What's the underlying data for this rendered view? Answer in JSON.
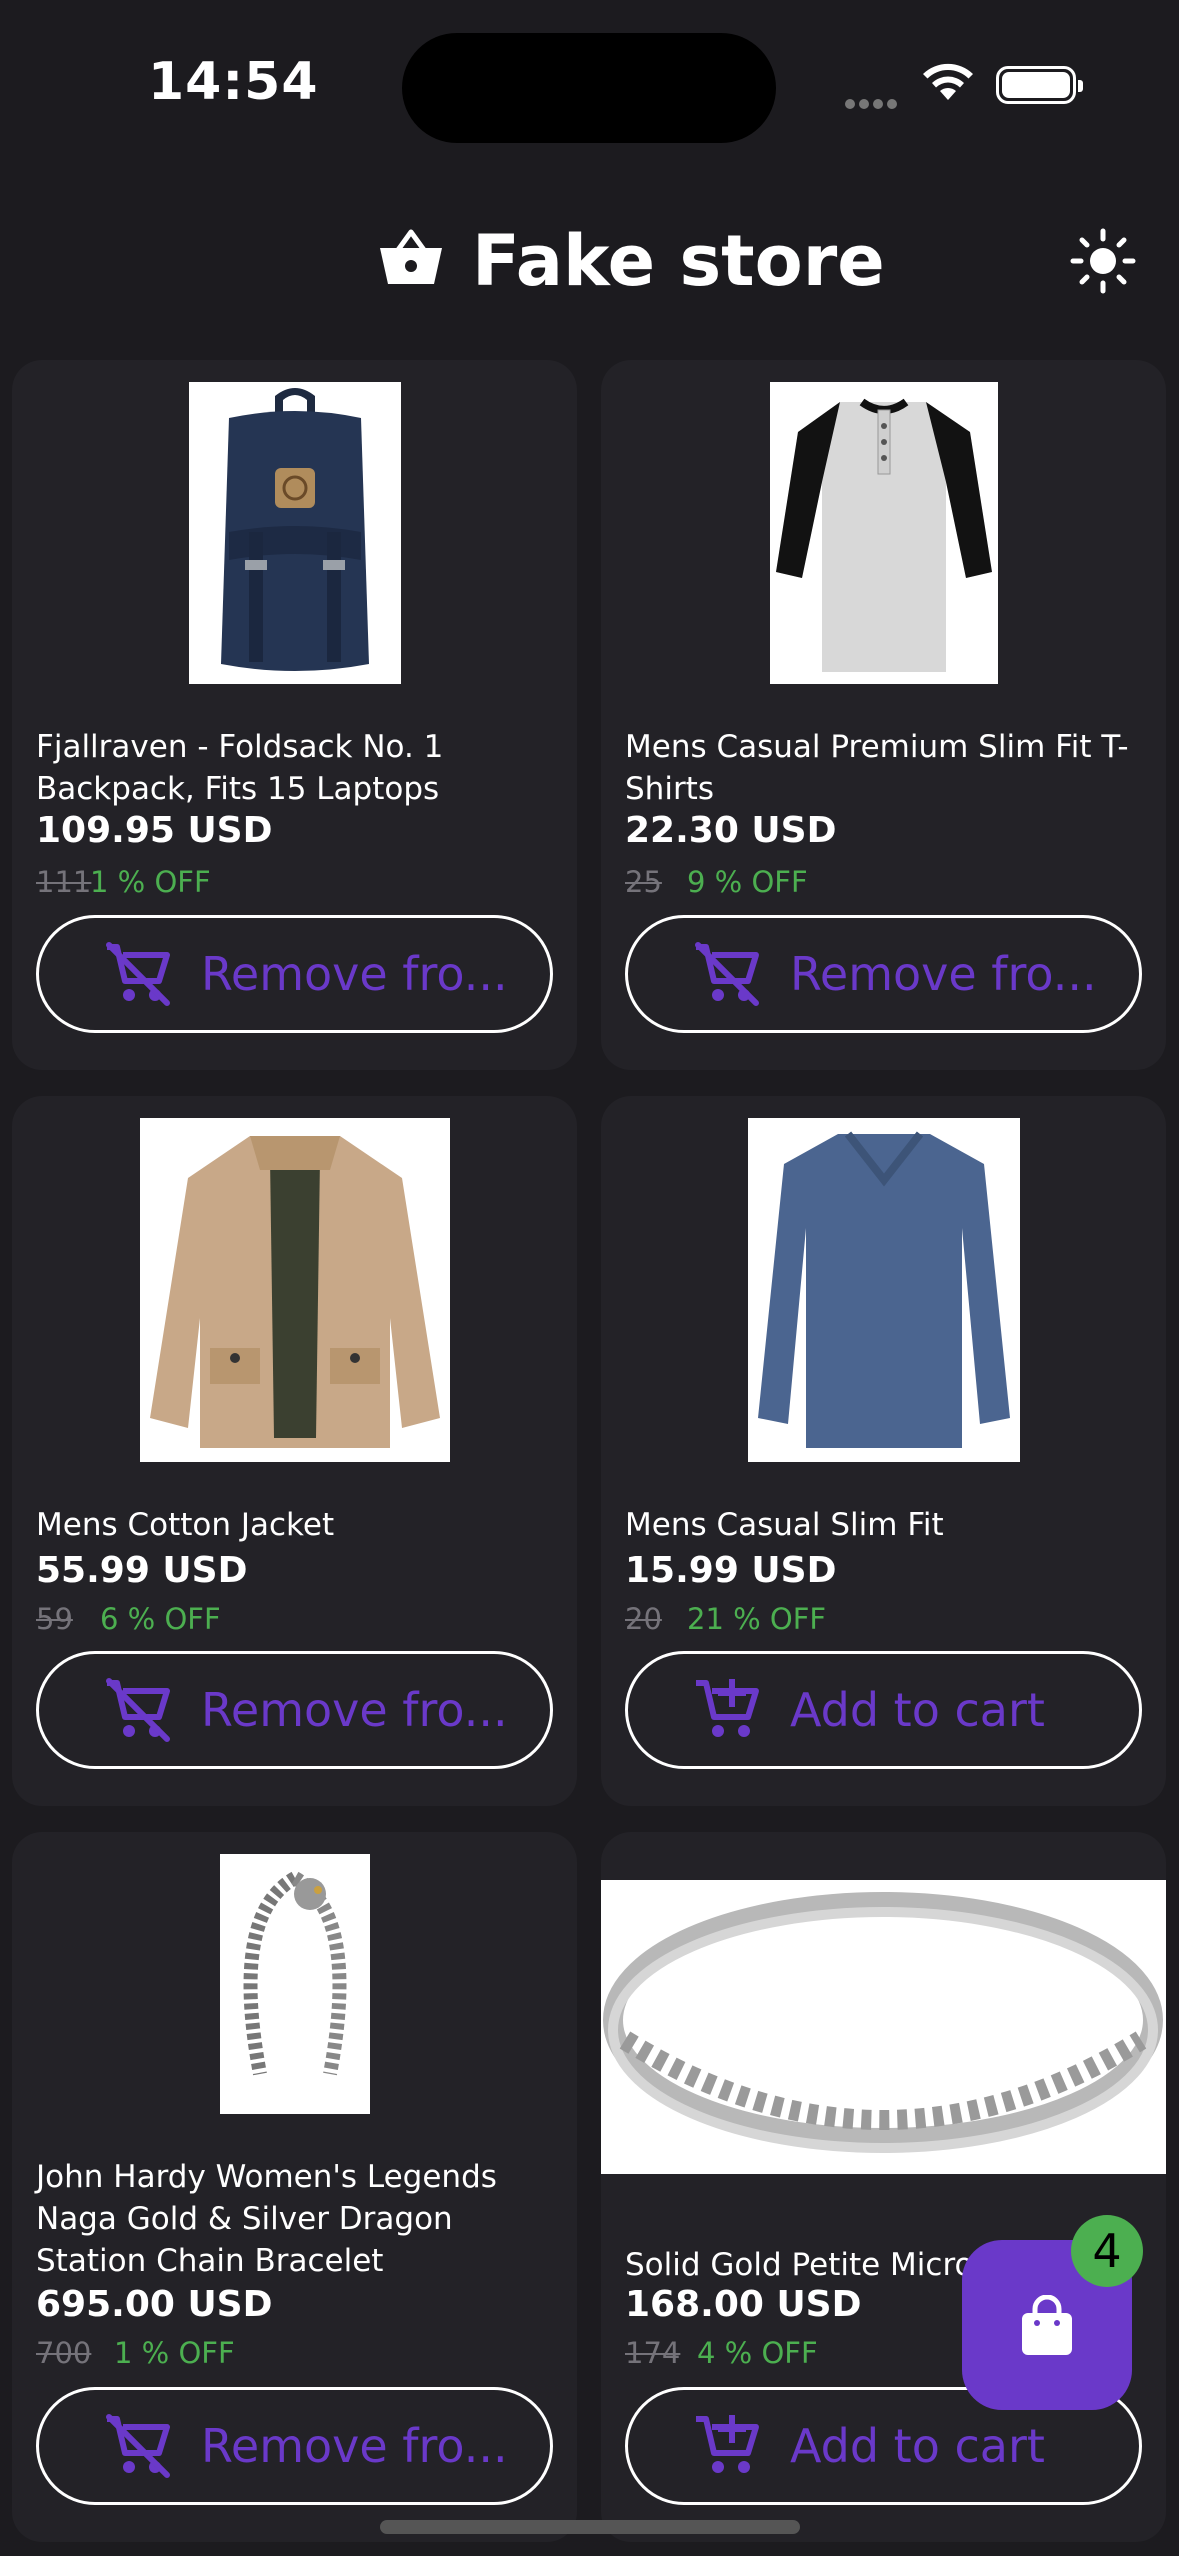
{
  "status": {
    "time": "14:54"
  },
  "header": {
    "title": "Fake store"
  },
  "cart": {
    "count": "4"
  },
  "products": [
    {
      "name": "Fjallraven - Foldsack No. 1 Backpack, Fits 15 Laptops",
      "price": "109.95 USD",
      "old": "111",
      "off": "1 % OFF",
      "button": "Remove fro...",
      "in_cart": true
    },
    {
      "name": "Mens Casual Premium Slim Fit T-Shirts",
      "price": "22.30 USD",
      "old": "25",
      "off": "9 % OFF",
      "button": "Remove fro...",
      "in_cart": true
    },
    {
      "name": "Mens Cotton Jacket",
      "price": "55.99 USD",
      "old": "59",
      "off": "6 % OFF",
      "button": "Remove fro...",
      "in_cart": true
    },
    {
      "name": "Mens Casual Slim Fit",
      "price": "15.99 USD",
      "old": "20",
      "off": "21 % OFF",
      "button": "Add to cart",
      "in_cart": false
    },
    {
      "name": "John Hardy Women's Legends Naga Gold & Silver Dragon Station Chain Bracelet",
      "price": "695.00 USD",
      "old": "700",
      "off": "1 % OFF",
      "button": "Remove fro...",
      "in_cart": true
    },
    {
      "name": "Solid Gold Petite Micro",
      "price": "168.00 USD",
      "old": "174",
      "off": "4 % OFF",
      "button": "Add to cart",
      "in_cart": false
    }
  ],
  "colors": {
    "accent": "#6a39c9",
    "discount": "#4caf50",
    "background": "#1c1b1f",
    "card": "#232227"
  }
}
